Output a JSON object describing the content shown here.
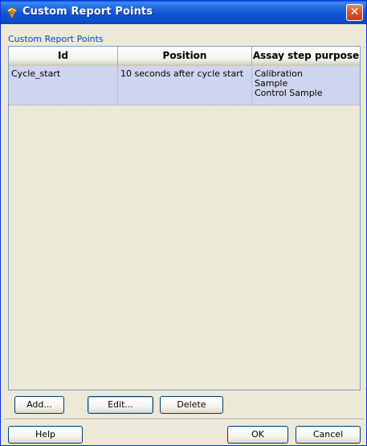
{
  "window": {
    "title": "Custom Report Points",
    "close_glyph": "✕"
  },
  "group": {
    "label": "Custom Report Points"
  },
  "table": {
    "columns": [
      "Id",
      "Position",
      "Assay step purpose"
    ],
    "rows": [
      {
        "id": "Cycle_start",
        "position": "10 seconds after cycle start",
        "purposes": [
          "Calibration",
          "Sample",
          "Control Sample"
        ],
        "selected": true
      }
    ]
  },
  "actions": {
    "add": "Add...",
    "edit": "Edit...",
    "delete": "Delete"
  },
  "footer": {
    "help": "Help",
    "ok": "OK",
    "cancel": "Cancel"
  },
  "colors": {
    "title_bar": "#0b55d3",
    "selected_row": "#cfd5ef",
    "dialog_bg": "#ece9d8",
    "group_label": "#0046d5"
  },
  "icons": {
    "app": "app-icon",
    "close": "close-icon"
  }
}
